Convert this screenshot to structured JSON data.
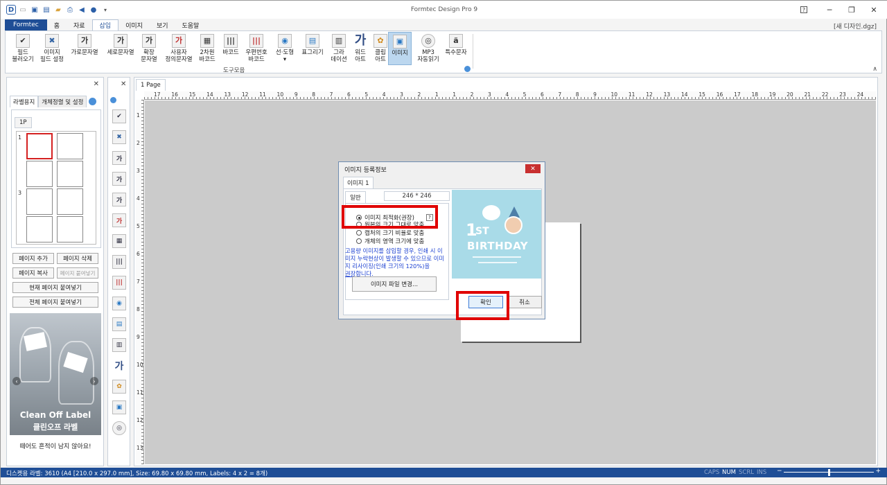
{
  "app": {
    "title": "Formtec Design Pro 9",
    "document": "[새 디자인.dgz]"
  },
  "quick_access": [
    "app-logo-icon",
    "new-file-icon",
    "save-icon",
    "save-as-icon",
    "open-folder-icon",
    "print-preview-icon",
    "back-arrow-icon",
    "dot-icon",
    "dropdown-icon"
  ],
  "window_buttons": {
    "help": "?",
    "minimize": "─",
    "restore": "❐",
    "close": "✕"
  },
  "tabs": [
    "Formtec",
    "홈",
    "자료",
    "삽입",
    "이미지",
    "보기",
    "도움말"
  ],
  "active_tab": "삽입",
  "ribbon": {
    "buttons": [
      {
        "id": "field-load",
        "label": "필드\n불러오기",
        "icon": "✔"
      },
      {
        "id": "image-field",
        "label": "이미지\n필드 설정",
        "icon": "✖"
      },
      {
        "id": "horizontal-text",
        "label": "가로문자열",
        "icon": "가"
      },
      {
        "id": "vertical-text",
        "label": "세로문자열",
        "icon": "가"
      },
      {
        "id": "expanded-text",
        "label": "확장\n문자열",
        "icon": "가"
      },
      {
        "id": "custom-text",
        "label": "사용자\n정의문자열",
        "icon": "가"
      },
      {
        "id": "qr-barcode",
        "label": "2차원\n바코드",
        "icon": "▦"
      },
      {
        "id": "barcode",
        "label": "바코드",
        "icon": "|||"
      },
      {
        "id": "postal-barcode",
        "label": "우편번호\n바코드",
        "icon": "|||"
      },
      {
        "id": "line-shape",
        "label": "선·도형",
        "icon": "◉"
      },
      {
        "id": "table",
        "label": "표그리기",
        "icon": "▤"
      },
      {
        "id": "gradation",
        "label": "그라\n데이션",
        "icon": "▥"
      },
      {
        "id": "word-art",
        "label": "워드\n아트",
        "icon": "가"
      },
      {
        "id": "clip-art",
        "label": "클립\n아트",
        "icon": "✿"
      },
      {
        "id": "image",
        "label": "이미지",
        "icon": "▣"
      },
      {
        "id": "mp3",
        "label": "MP3\n자동읽기",
        "icon": "◎"
      },
      {
        "id": "special-char",
        "label": "특수문자",
        "icon": "ä"
      }
    ],
    "group_label": "도구모음",
    "selected": "이미지"
  },
  "left_panel": {
    "tabs": [
      "라벨용지",
      "개체정렬 및 설정"
    ],
    "page_tab": "1P",
    "row_numbers": [
      "1",
      "3"
    ],
    "buttons": {
      "add_page": "페이지 추가",
      "delete_page": "페이지 삭제",
      "copy_page": "페이지 복사",
      "paste_page": "페이지 붙여넣기",
      "paste_current": "현재 페이지 붙여넣기",
      "paste_all": "전체 페이지 붙여넣기"
    },
    "ad": {
      "brand": "Clean Off Label",
      "brand_ko": "클린오프 라벨",
      "tagline": "떼어도 흔적이 남지 않아요!"
    }
  },
  "tools_column": [
    "check-icon",
    "image-field-icon",
    "horizontal-text-icon",
    "vertical-text-icon",
    "expanded-text-icon",
    "custom-text-icon",
    "qr-icon",
    "barcode-icon",
    "postal-barcode-icon",
    "shape-icon",
    "table-icon",
    "gradation-icon",
    "word-art-icon",
    "clip-art-icon",
    "image-icon",
    "mp3-icon"
  ],
  "document": {
    "page_tab": "1 Page",
    "ruler_top": [
      "17",
      "16",
      "15",
      "14",
      "13",
      "12",
      "11",
      "10",
      "9",
      "8",
      "7",
      "6",
      "5",
      "4",
      "3",
      "2",
      "1",
      "1",
      "2",
      "3",
      "4",
      "5",
      "6",
      "7",
      "8",
      "9",
      "10",
      "11",
      "12",
      "13",
      "14",
      "15",
      "16",
      "17",
      "18",
      "19",
      "20",
      "21",
      "22",
      "23",
      "24"
    ],
    "ruler_left": [
      "1",
      "2",
      "3",
      "4",
      "5",
      "6",
      "7",
      "8",
      "9",
      "10",
      "11",
      "12",
      "13"
    ]
  },
  "dialog": {
    "title": "이미지 등록정보",
    "tab": "이미지 1",
    "general_tab": "일반",
    "size": "246 * 246",
    "options": [
      {
        "label": "이미지 최적화(권장)",
        "checked": true
      },
      {
        "label": "원본의 크기 그대로 맞춤",
        "checked": false
      },
      {
        "label": "캡처의 크기 비율로 맞춤",
        "checked": false
      },
      {
        "label": "개체의 영역 크기에 맞춤",
        "checked": false
      }
    ],
    "help": "?",
    "note": "고용량 이미지를 삽입할 경우, 인쇄 시 이미지 누락현상이 발생할 수 있으므로 이미지 리사이징(인쇄 크기의 120%)을",
    "note_link": "권장",
    "note_tail": "합니다.",
    "change_button": "이미지 파일 변경...",
    "preview": {
      "big": "1",
      "suffix": "ST",
      "headline": "BIRTHDAY"
    },
    "ok": "확인",
    "cancel": "취소"
  },
  "status": {
    "text": "디스켓용 라벨: 3610 (A4 [210.0 x 297.0 mm], Size: 69.80 x 69.80 mm,  Labels: 4 x 2 = 8개)",
    "indicators": {
      "caps": "CAPS",
      "num": "NUM",
      "scrl": "SCRL",
      "ins": "INS"
    },
    "zoom_minus": "−",
    "zoom_plus": "+",
    "zoom_level": 0.5
  },
  "colors": {
    "accent": "#1f4e96",
    "highlight": "#e00000",
    "selected_ribbon": "#bcd7ef",
    "canvas": "#cbcbcb"
  }
}
